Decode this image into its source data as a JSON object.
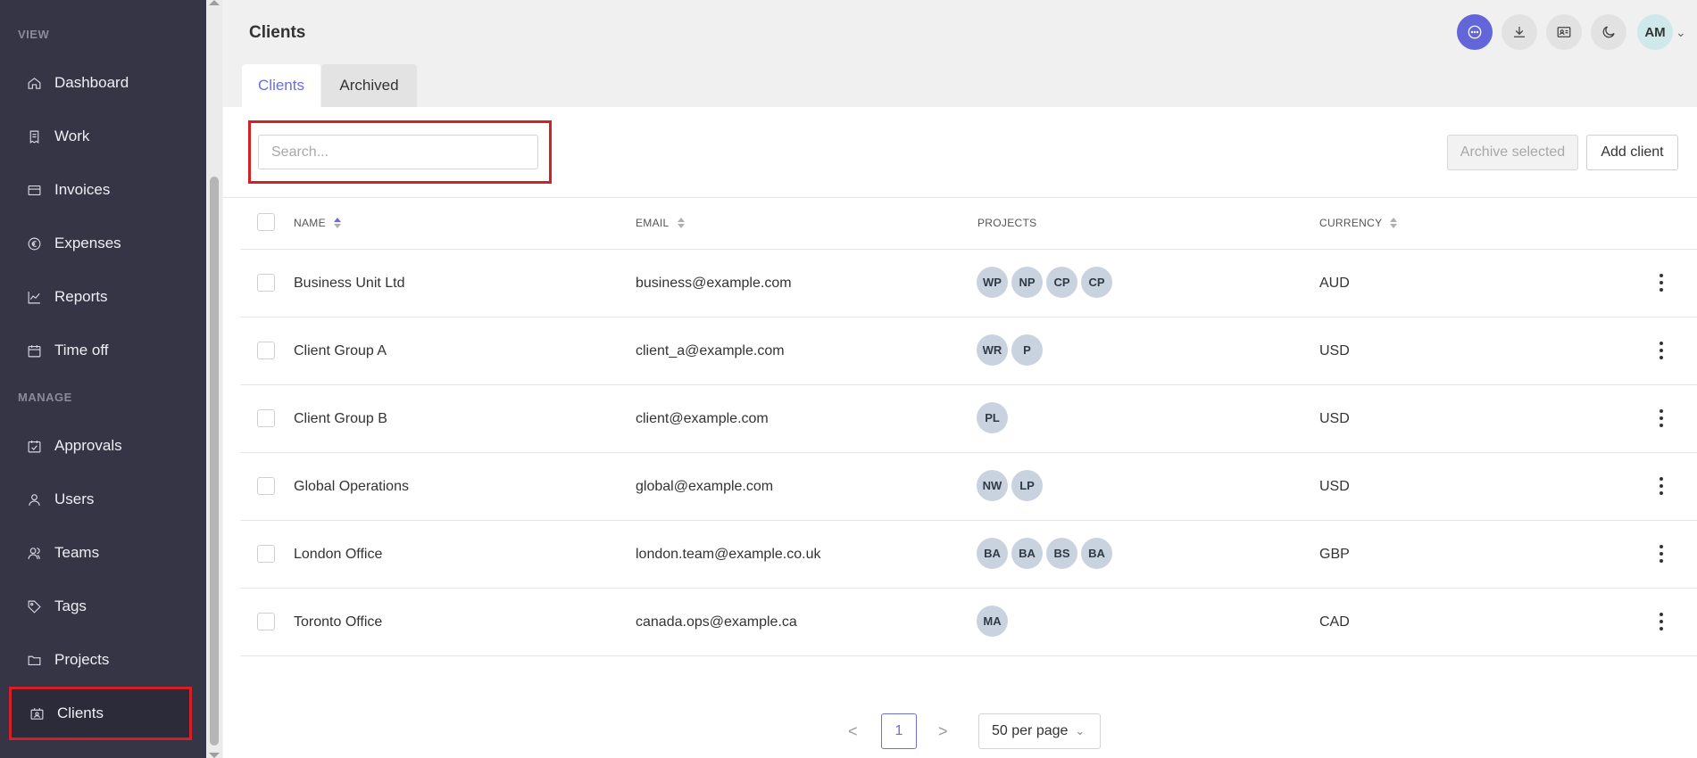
{
  "sidebar": {
    "sections": [
      {
        "label": "VIEW"
      },
      {
        "label": "MANAGE"
      }
    ],
    "view_items": [
      {
        "label": "Dashboard",
        "icon": "home-icon"
      },
      {
        "label": "Work",
        "icon": "receipt-icon"
      },
      {
        "label": "Invoices",
        "icon": "card-icon"
      },
      {
        "label": "Expenses",
        "icon": "euro-icon"
      },
      {
        "label": "Reports",
        "icon": "chart-icon"
      },
      {
        "label": "Time off",
        "icon": "calendar-icon"
      }
    ],
    "manage_items": [
      {
        "label": "Approvals",
        "icon": "calendar-check-icon"
      },
      {
        "label": "Users",
        "icon": "user-icon"
      },
      {
        "label": "Teams",
        "icon": "team-icon"
      },
      {
        "label": "Tags",
        "icon": "tag-icon"
      },
      {
        "label": "Projects",
        "icon": "folder-icon"
      },
      {
        "label": "Clients",
        "icon": "client-card-icon",
        "active": true
      }
    ]
  },
  "header": {
    "title": "Clients",
    "avatar_initials": "AM",
    "accent_color": "#6366d8"
  },
  "tabs": [
    {
      "label": "Clients",
      "active": true
    },
    {
      "label": "Archived",
      "active": false
    }
  ],
  "toolbar": {
    "search_placeholder": "Search...",
    "archive_label": "Archive selected",
    "add_label": "Add client"
  },
  "table": {
    "columns": [
      "NAME",
      "EMAIL",
      "PROJECTS",
      "CURRENCY"
    ],
    "rows": [
      {
        "name": "Business Unit Ltd",
        "email": "business@example.com",
        "projects": [
          "WP",
          "NP",
          "CP",
          "CP"
        ],
        "currency": "AUD"
      },
      {
        "name": "Client Group A",
        "email": "client_a@example.com",
        "projects": [
          "WR",
          "P"
        ],
        "currency": "USD"
      },
      {
        "name": "Client Group B",
        "email": "client@example.com",
        "projects": [
          "PL"
        ],
        "currency": "USD"
      },
      {
        "name": "Global Operations",
        "email": "global@example.com",
        "projects": [
          "NW",
          "LP"
        ],
        "currency": "USD"
      },
      {
        "name": "London Office",
        "email": "london.team@example.co.uk",
        "projects": [
          "BA",
          "BA",
          "BS",
          "BA"
        ],
        "currency": "GBP"
      },
      {
        "name": "Toronto Office",
        "email": "canada.ops@example.ca",
        "projects": [
          "MA"
        ],
        "currency": "CAD"
      }
    ]
  },
  "pagination": {
    "current_page": "1",
    "page_size_label": "50 per page",
    "prev_symbol": "<",
    "next_symbol": ">"
  }
}
